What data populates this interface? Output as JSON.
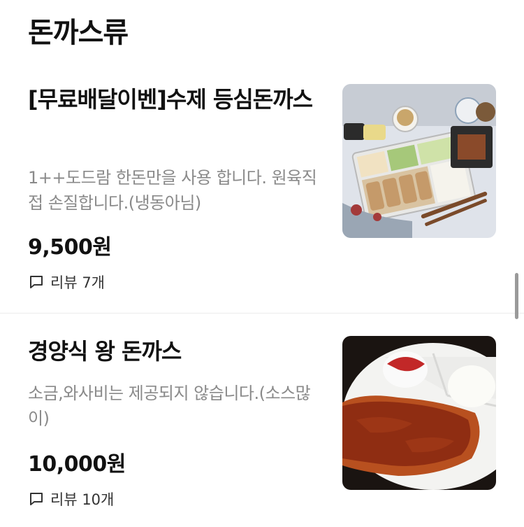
{
  "category": {
    "title": "돈까스류"
  },
  "menu_items": [
    {
      "name": "[무료배달이벤]수제 등심돈까스",
      "description": "1++도드람 한돈만을 사용 합니다. 원육직접 손질합니다.(냉동아님)",
      "price": "9,500원",
      "review": "리뷰 7개",
      "photo_icon": "tonkatsu-bento-photo"
    },
    {
      "name": "경양식 왕 돈까스",
      "description": "소금,와사비는 제공되지 않습니다.(소스많이)",
      "price": "10,000원",
      "review": "리뷰 10개",
      "photo_icon": "western-tonkatsu-photo"
    }
  ],
  "colors": {
    "text_primary": "#111111",
    "text_secondary": "#8a8a8a",
    "divider": "#ececec",
    "scrollbar": "#9a9a9a"
  }
}
